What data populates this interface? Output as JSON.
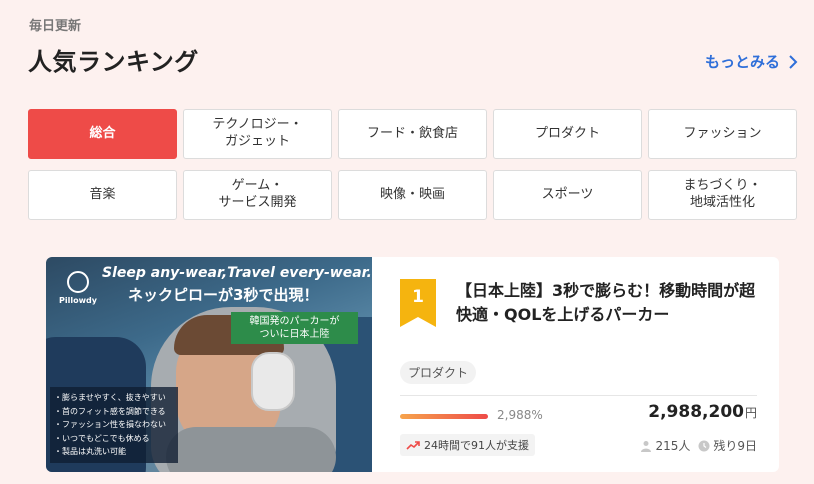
{
  "header": {
    "updated_label": "毎日更新",
    "title": "人気ランキング",
    "more_label": "もっとみる"
  },
  "categories": [
    {
      "label": "総合",
      "active": true
    },
    {
      "label": "テクノロジー・\nガジェット",
      "active": false
    },
    {
      "label": "フード・飲食店",
      "active": false
    },
    {
      "label": "プロダクト",
      "active": false
    },
    {
      "label": "ファッション",
      "active": false
    },
    {
      "label": "音楽",
      "active": false
    },
    {
      "label": "ゲーム・\nサービス開発",
      "active": false
    },
    {
      "label": "映像・映画",
      "active": false
    },
    {
      "label": "スポーツ",
      "active": false
    },
    {
      "label": "まちづくり・\n地域活性化",
      "active": false
    }
  ],
  "card": {
    "image": {
      "brand": "Pillowdy",
      "headline_en": "Sleep any-wear,Travel every-wear.",
      "headline_jp": "ネックピローが3秒で出現！",
      "tag": "韓国発のパーカーが\nついに日本上陸",
      "features": [
        "・膨らませやすく、抜きやすい",
        "・首のフィット感を調節できる",
        "・ファッション性を損なわない",
        "・いつでもどこでも休める",
        "・製品は丸洗い可能"
      ]
    },
    "rank": "1",
    "title": "【日本上陸】3秒で膨らむ！移動時間が超快適・QOLを上げるパーカー",
    "category": "プロダクト",
    "progress_percent": 2988,
    "percent_label": "2,988%",
    "amount": "2,988,200",
    "currency": "円",
    "trend_label": "24時間で91人が支援",
    "supporters": "215人",
    "remaining": "残り9日",
    "colors": {
      "accent": "#ee4b48",
      "rank_badge": "#f5b40f",
      "link": "#2f6fd9"
    }
  }
}
